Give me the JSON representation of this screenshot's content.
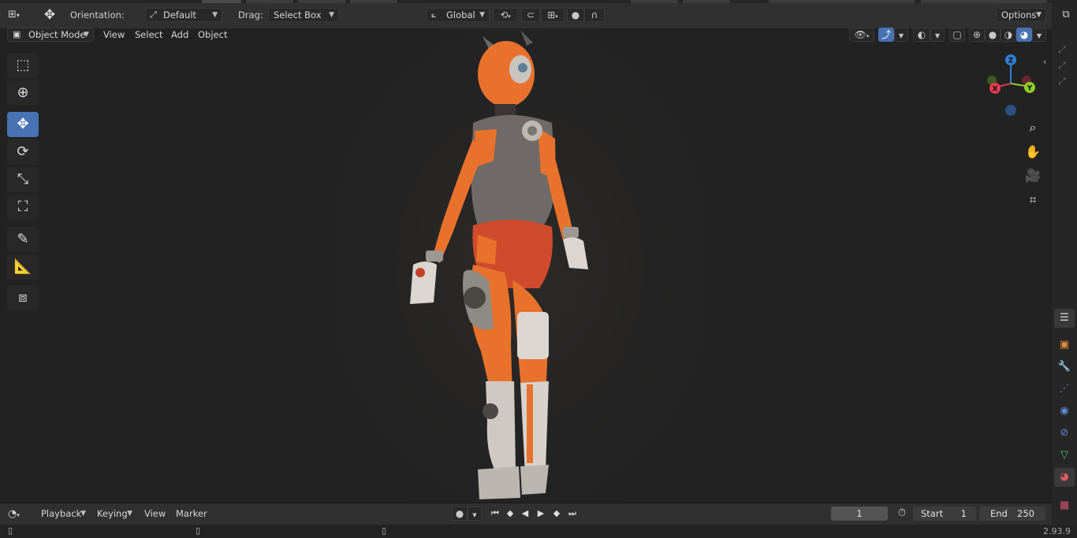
{
  "header": {
    "orientation_label": "Orientation:",
    "orientation_value": "Default",
    "drag_label": "Drag:",
    "drag_value": "Select Box",
    "transform_space": "Global",
    "options_label": "Options"
  },
  "viewport_header": {
    "mode": "Object Mode",
    "menus": [
      "View",
      "Select",
      "Add",
      "Object"
    ]
  },
  "gizmo": {
    "z": "Z",
    "y": "Y",
    "x": "X"
  },
  "toolbar": {
    "tools": [
      {
        "name": "select-box",
        "icon": "select-box-icon"
      },
      {
        "name": "cursor",
        "icon": "cursor-icon"
      },
      {
        "name": "move",
        "icon": "move-icon",
        "active": true
      },
      {
        "name": "rotate",
        "icon": "rotate-icon"
      },
      {
        "name": "scale",
        "icon": "scale-icon"
      },
      {
        "name": "transform",
        "icon": "transform-icon"
      },
      {
        "name": "annotate",
        "icon": "annotate-icon"
      },
      {
        "name": "measure",
        "icon": "measure-icon"
      },
      {
        "name": "add-cube",
        "icon": "add-cube-icon"
      }
    ]
  },
  "timeline": {
    "menus": [
      "Playback",
      "Keying",
      "View",
      "Marker"
    ],
    "current_frame": "1",
    "start_label": "Start",
    "start_value": "1",
    "end_label": "End",
    "end_value": "250"
  },
  "status": {
    "version": "2.93.9"
  },
  "colors": {
    "accent": "#4772b3",
    "axis_x": "#e63a51",
    "axis_y": "#8ccf2a",
    "axis_z": "#2f7fd6",
    "suit_orange": "#e8722c"
  }
}
